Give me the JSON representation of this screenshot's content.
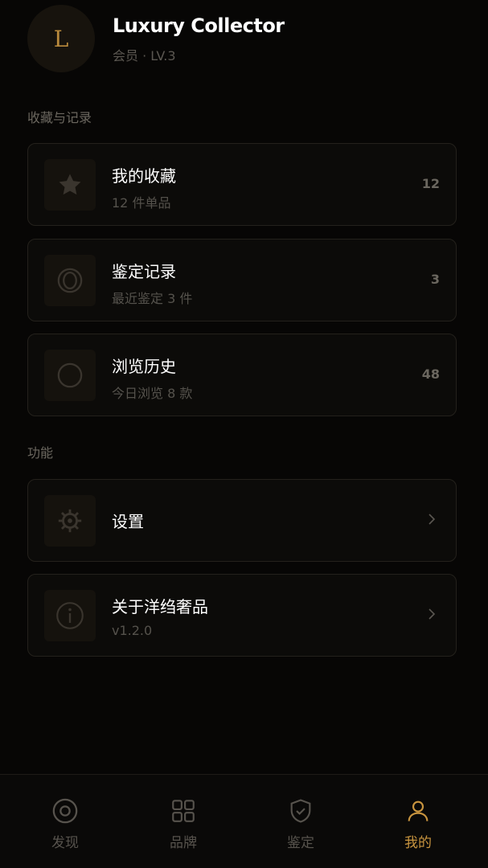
{
  "profile": {
    "avatar_letter": "L",
    "name": "Luxury Collector",
    "level": "会员 · LV.3"
  },
  "sections": {
    "records_title": "收藏与记录",
    "functions_title": "功能"
  },
  "records": [
    {
      "title": "我的收藏",
      "subtitle": "12 件单品",
      "count": "12",
      "icon": "star-icon"
    },
    {
      "title": "鉴定记录",
      "subtitle": "最近鉴定 3 件",
      "count": "3",
      "icon": "double-circle-icon"
    },
    {
      "title": "浏览历史",
      "subtitle": "今日浏览 8 款",
      "count": "48",
      "icon": "circle-icon"
    }
  ],
  "functions": [
    {
      "title": "设置",
      "icon": "gear-icon"
    },
    {
      "title": "关于洋绉奢品",
      "subtitle": "v1.2.0",
      "icon": "info-icon"
    }
  ],
  "tabs": [
    {
      "label": "发现",
      "icon": "discover-icon",
      "active": false
    },
    {
      "label": "品牌",
      "icon": "grid-icon",
      "active": false
    },
    {
      "label": "鉴定",
      "icon": "shield-check-icon",
      "active": false
    },
    {
      "label": "我的",
      "icon": "user-icon",
      "active": true
    }
  ],
  "colors": {
    "background": "#070605",
    "accent": "#c9953f",
    "card_border": "#24211c",
    "muted_text": "#55524c"
  }
}
